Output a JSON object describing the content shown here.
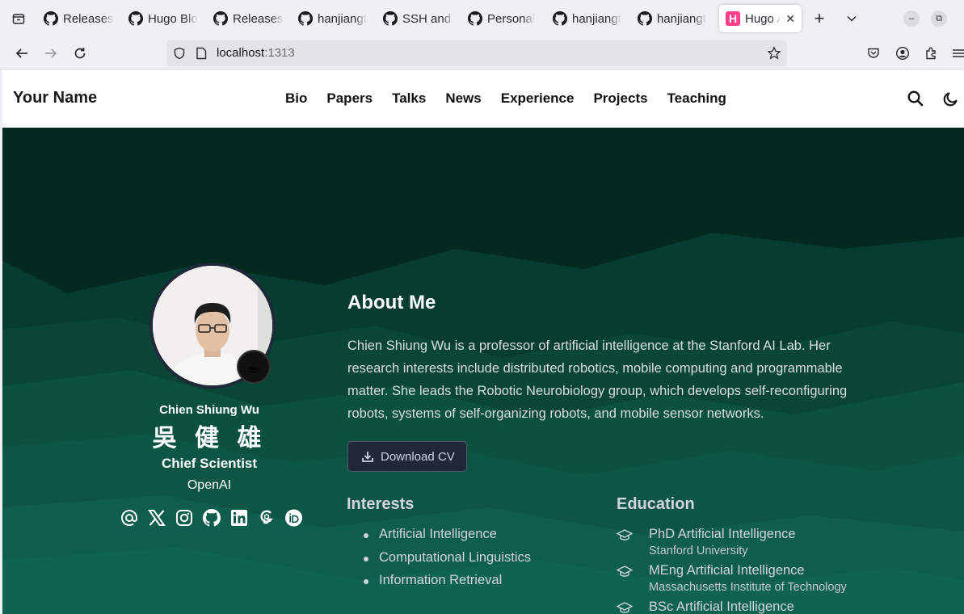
{
  "browser": {
    "tabs": [
      {
        "label": "Releases",
        "icon": "github-icon"
      },
      {
        "label": "Hugo Blo",
        "icon": "github-icon"
      },
      {
        "label": "Releases",
        "icon": "github-icon"
      },
      {
        "label": "hanjiangt",
        "icon": "github-icon"
      },
      {
        "label": "SSH and G",
        "icon": "github-icon"
      },
      {
        "label": "Personal",
        "icon": "github-icon"
      },
      {
        "label": "hanjiangt",
        "icon": "github-icon"
      },
      {
        "label": "hanjiangt",
        "icon": "github-icon"
      },
      {
        "label": "Hugo A",
        "icon": "hugo-icon",
        "active": true
      }
    ],
    "url_host": "localhost",
    "url_port": ":1313",
    "favicon_letter": "H"
  },
  "site": {
    "brand": "Your Name",
    "menu": [
      "Bio",
      "Papers",
      "Talks",
      "News",
      "Experience",
      "Projects",
      "Teaching"
    ]
  },
  "profile": {
    "name": "Chien Shiung Wu",
    "name_cn": "吳 健 雄",
    "role": "Chief Scientist",
    "org": "OpenAI",
    "status_emoji": "☕",
    "socials": [
      "at-icon",
      "x-icon",
      "instagram-icon",
      "github-icon",
      "linkedin-icon",
      "google-scholar-icon",
      "orcid-icon"
    ]
  },
  "about": {
    "title": "About Me",
    "text": "Chien Shiung Wu is a professor of artificial intelligence at the Stanford AI Lab. Her research interests include distributed robotics, mobile computing and programmable matter. She leads the Robotic Neurobiology group, which develops self-reconfiguring robots, systems of self-organizing robots, and mobile sensor networks.",
    "cv_label": "Download CV"
  },
  "interests": {
    "title": "Interests",
    "items": [
      "Artificial Intelligence",
      "Computational Linguistics",
      "Information Retrieval"
    ]
  },
  "education": {
    "title": "Education",
    "items": [
      {
        "degree": "PhD Artificial Intelligence",
        "institution": "Stanford University"
      },
      {
        "degree": "MEng Artificial Intelligence",
        "institution": "Massachusetts Institute of Technology"
      },
      {
        "degree": "BSc Artificial Intelligence",
        "institution": ""
      }
    ]
  },
  "colors": {
    "hero_bg": "#052e22",
    "accent": "#ff4088"
  }
}
